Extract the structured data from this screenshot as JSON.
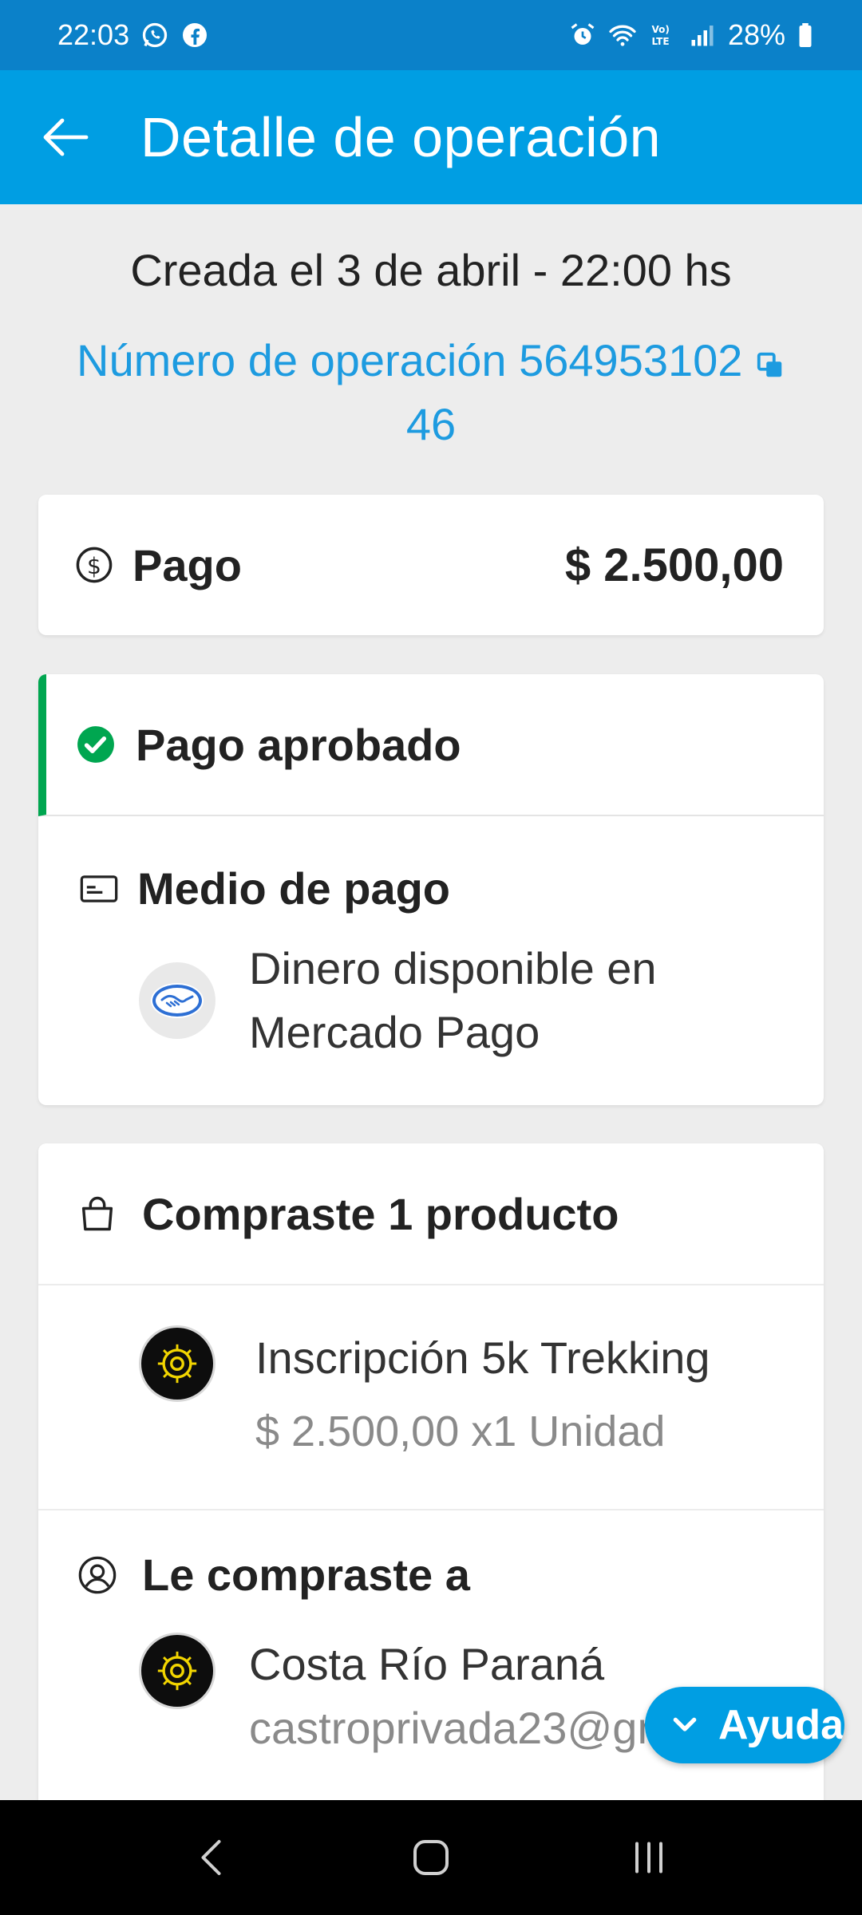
{
  "status_bar": {
    "time": "22:03",
    "battery": "28%",
    "network": "VoLTE"
  },
  "app_bar": {
    "title": "Detalle de operación"
  },
  "operation": {
    "created": "Creada el 3 de abril - 22:00 hs",
    "number_line1": "Número de operación 564953102",
    "number_line2": "46"
  },
  "payment": {
    "label": "Pago",
    "amount": "$ 2.500,00"
  },
  "status": {
    "label": "Pago aprobado",
    "method_title": "Medio de pago",
    "method_line1": "Dinero disponible en",
    "method_line2": "Mercado Pago"
  },
  "products": {
    "heading": "Compraste 1 producto",
    "items": [
      {
        "name": "Inscripción 5k Trekking",
        "price": "$ 2.500,00 x1 Unidad"
      }
    ]
  },
  "seller": {
    "heading": "Le compraste a",
    "name": "Costa Río Paraná",
    "email": "castroprivada23@gmail"
  },
  "help_button": {
    "label": "Ayuda"
  },
  "colors": {
    "status_bar": "#0b81c9",
    "app_bar": "#009ee3",
    "link": "#1d9be0",
    "approved": "#00a650",
    "background": "#ededed"
  },
  "icons": {
    "back": "arrow-left-icon",
    "copy": "copy-icon",
    "payment": "dollar-circle-icon",
    "approved": "check-circle-icon",
    "method": "credit-card-icon",
    "bag": "shopping-bag-icon",
    "user": "user-circle-icon",
    "help": "chevron-down-icon"
  }
}
